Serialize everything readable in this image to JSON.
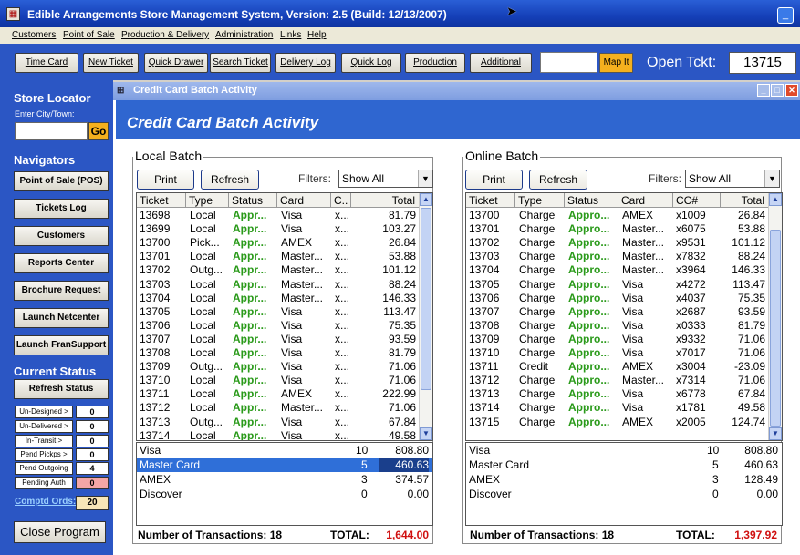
{
  "app": {
    "title": "Edible Arrangements Store Management System, Version: 2.5 (Build: 12/13/2007)",
    "window_min": "_"
  },
  "menu": [
    "Customers",
    "Point of Sale",
    "Production & Delivery",
    "Administration",
    "Links",
    "Help"
  ],
  "toolbar": {
    "buttons": [
      "Time Card",
      "New Ticket",
      "Quick Drawer",
      "Search Ticket",
      "Delivery Log",
      "Quick Log",
      "Production",
      "Additional"
    ],
    "map_it": "Map It",
    "open_ticket_label": "Open Tckt:",
    "open_ticket_value": "13715"
  },
  "sidebar": {
    "store_locator": "Store Locator",
    "enter_city": "Enter City/Town:",
    "go": "Go",
    "navigators": "Navigators",
    "nav_buttons": [
      "Point of Sale (POS)",
      "Tickets Log",
      "Customers",
      "Reports Center",
      "Brochure Request",
      "Launch Netcenter",
      "Launch FranSupport"
    ],
    "current_status": "Current Status",
    "refresh_status": "Refresh Status",
    "status_rows": [
      {
        "label": "Un-Designed >",
        "value": "0"
      },
      {
        "label": "Un-Delivered >",
        "value": "0"
      },
      {
        "label": "In-Transit >",
        "value": "0"
      },
      {
        "label": "Pend Pickps >",
        "value": "0"
      },
      {
        "label": "Pend Outgoing",
        "value": "4"
      },
      {
        "label": "Pending Auth",
        "value": "0"
      }
    ],
    "comptd_label": "Comptd Ords:",
    "comptd_value": "20",
    "close_program": "Close Program"
  },
  "child": {
    "title": "Credit Card Batch Activity",
    "header": "Credit Card Batch Activity"
  },
  "local": {
    "title": "Local Batch",
    "print": "Print",
    "refresh": "Refresh",
    "filters_label": "Filters:",
    "filter_value": "Show All",
    "columns": [
      "Ticket",
      "Type",
      "Status",
      "Card",
      "C..",
      "Total"
    ],
    "rows": [
      [
        "13698",
        "Local",
        "Appr...",
        "Visa",
        "x...",
        "81.79"
      ],
      [
        "13699",
        "Local",
        "Appr...",
        "Visa",
        "x...",
        "103.27"
      ],
      [
        "13700",
        "Pick...",
        "Appr...",
        "AMEX",
        "x...",
        "26.84"
      ],
      [
        "13701",
        "Local",
        "Appr...",
        "Master...",
        "x...",
        "53.88"
      ],
      [
        "13702",
        "Outg...",
        "Appr...",
        "Master...",
        "x...",
        "101.12"
      ],
      [
        "13703",
        "Local",
        "Appr...",
        "Master...",
        "x...",
        "88.24"
      ],
      [
        "13704",
        "Local",
        "Appr...",
        "Master...",
        "x...",
        "146.33"
      ],
      [
        "13705",
        "Local",
        "Appr...",
        "Visa",
        "x...",
        "113.47"
      ],
      [
        "13706",
        "Local",
        "Appr...",
        "Visa",
        "x...",
        "75.35"
      ],
      [
        "13707",
        "Local",
        "Appr...",
        "Visa",
        "x...",
        "93.59"
      ],
      [
        "13708",
        "Local",
        "Appr...",
        "Visa",
        "x...",
        "81.79"
      ],
      [
        "13709",
        "Outg...",
        "Appr...",
        "Visa",
        "x...",
        "71.06"
      ],
      [
        "13710",
        "Local",
        "Appr...",
        "Visa",
        "x...",
        "71.06"
      ],
      [
        "13711",
        "Local",
        "Appr...",
        "AMEX",
        "x...",
        "222.99"
      ],
      [
        "13712",
        "Local",
        "Appr...",
        "Master...",
        "x...",
        "71.06"
      ],
      [
        "13713",
        "Outg...",
        "Appr...",
        "Visa",
        "x...",
        "67.84"
      ],
      [
        "13714",
        "Local",
        "Appr...",
        "Visa",
        "x...",
        "49.58"
      ]
    ],
    "summary": [
      {
        "card": "Visa",
        "count": "10",
        "amount": "808.80"
      },
      {
        "card": "Master Card",
        "count": "5",
        "amount": "460.63"
      },
      {
        "card": "AMEX",
        "count": "3",
        "amount": "374.57"
      },
      {
        "card": "Discover",
        "count": "0",
        "amount": "0.00"
      }
    ],
    "num_transactions": "Number of Transactions: 18",
    "total_label": "TOTAL:",
    "total_value": "1,644.00"
  },
  "online": {
    "title": "Online Batch",
    "print": "Print",
    "refresh": "Refresh",
    "filters_label": "Filters:",
    "filter_value": "Show All",
    "columns": [
      "Ticket",
      "Type",
      "Status",
      "Card",
      "CC#",
      "Total"
    ],
    "rows": [
      [
        "13700",
        "Charge",
        "Appro...",
        "AMEX",
        "x1009",
        "26.84"
      ],
      [
        "13701",
        "Charge",
        "Appro...",
        "Master...",
        "x6075",
        "53.88"
      ],
      [
        "13702",
        "Charge",
        "Appro...",
        "Master...",
        "x9531",
        "101.12"
      ],
      [
        "13703",
        "Charge",
        "Appro...",
        "Master...",
        "x7832",
        "88.24"
      ],
      [
        "13704",
        "Charge",
        "Appro...",
        "Master...",
        "x3964",
        "146.33"
      ],
      [
        "13705",
        "Charge",
        "Appro...",
        "Visa",
        "x4272",
        "113.47"
      ],
      [
        "13706",
        "Charge",
        "Appro...",
        "Visa",
        "x4037",
        "75.35"
      ],
      [
        "13707",
        "Charge",
        "Appro...",
        "Visa",
        "x2687",
        "93.59"
      ],
      [
        "13708",
        "Charge",
        "Appro...",
        "Visa",
        "x0333",
        "81.79"
      ],
      [
        "13709",
        "Charge",
        "Appro...",
        "Visa",
        "x9332",
        "71.06"
      ],
      [
        "13710",
        "Charge",
        "Appro...",
        "Visa",
        "x7017",
        "71.06"
      ],
      [
        "13711",
        "Credit",
        "Appro...",
        "AMEX",
        "x3004",
        "-23.09"
      ],
      [
        "13712",
        "Charge",
        "Appro...",
        "Master...",
        "x7314",
        "71.06"
      ],
      [
        "13713",
        "Charge",
        "Appro...",
        "Visa",
        "x6778",
        "67.84"
      ],
      [
        "13714",
        "Charge",
        "Appro...",
        "Visa",
        "x1781",
        "49.58"
      ],
      [
        "13715",
        "Charge",
        "Appro...",
        "AMEX",
        "x2005",
        "124.74"
      ]
    ],
    "summary": [
      {
        "card": "Visa",
        "count": "10",
        "amount": "808.80"
      },
      {
        "card": "Master Card",
        "count": "5",
        "amount": "460.63"
      },
      {
        "card": "AMEX",
        "count": "3",
        "amount": "128.49"
      },
      {
        "card": "Discover",
        "count": "0",
        "amount": "0.00"
      }
    ],
    "num_transactions": "Number of Transactions: 18",
    "total_label": "TOTAL:",
    "total_value": "1,397.92"
  },
  "colors": {
    "toolbar_blue": "#2b56c4",
    "approved_green": "#2a9a1a",
    "total_red": "#d01010",
    "map_it_orange": "#f5b01e"
  },
  "icons": {
    "app": "app-icon",
    "cursor": "mouse-cursor-icon"
  }
}
